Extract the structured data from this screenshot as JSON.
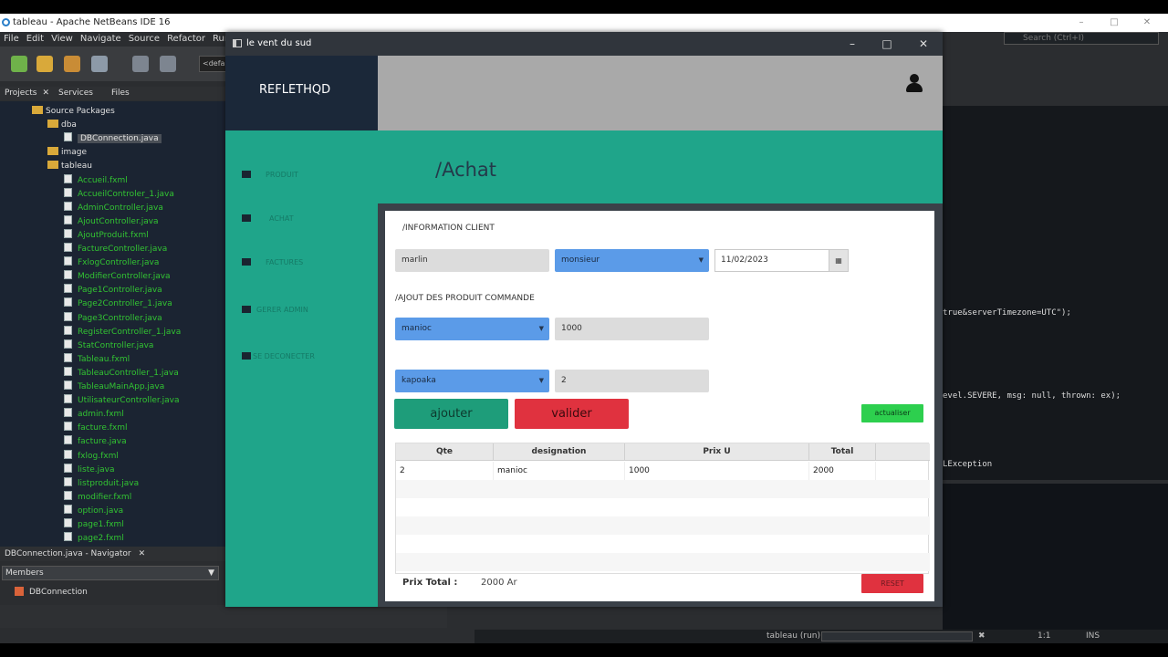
{
  "ide": {
    "title": "tableau - Apache NetBeans IDE 16",
    "menu": [
      "File",
      "Edit",
      "View",
      "Navigate",
      "Source",
      "Refactor",
      "Run"
    ],
    "toolbar_combo": "<defa",
    "search_placeholder": "Search (Ctrl+I)",
    "tabs": [
      "Projects",
      "Services",
      "Files"
    ],
    "tree": [
      {
        "label": "Source Packages",
        "color": "white",
        "kind": "pk",
        "indent": 35
      },
      {
        "label": "dba",
        "color": "white",
        "kind": "pk",
        "indent": 52
      },
      {
        "label": "DBConnection.java",
        "color": "white",
        "kind": "fi",
        "indent": 70,
        "selected": true
      },
      {
        "label": "image",
        "color": "white",
        "kind": "pk",
        "indent": 52
      },
      {
        "label": "tableau",
        "color": "white",
        "kind": "pk",
        "indent": 52
      },
      {
        "label": "Accueil.fxml",
        "color": "green",
        "kind": "fi",
        "indent": 70
      },
      {
        "label": "AccueilControler_1.java",
        "color": "green",
        "kind": "fi",
        "indent": 70
      },
      {
        "label": "AdminController.java",
        "color": "green",
        "kind": "fi",
        "indent": 70
      },
      {
        "label": "AjoutController.java",
        "color": "green",
        "kind": "fi",
        "indent": 70
      },
      {
        "label": "AjoutProduit.fxml",
        "color": "green",
        "kind": "fi",
        "indent": 70
      },
      {
        "label": "FactureController.java",
        "color": "green",
        "kind": "fi",
        "indent": 70
      },
      {
        "label": "FxlogController.java",
        "color": "green",
        "kind": "fi",
        "indent": 70
      },
      {
        "label": "ModifierController.java",
        "color": "green",
        "kind": "fi",
        "indent": 70
      },
      {
        "label": "Page1Controller.java",
        "color": "green",
        "kind": "fi",
        "indent": 70
      },
      {
        "label": "Page2Controller_1.java",
        "color": "green",
        "kind": "fi",
        "indent": 70
      },
      {
        "label": "Page3Controller.java",
        "color": "green",
        "kind": "fi",
        "indent": 70
      },
      {
        "label": "RegisterController_1.java",
        "color": "green",
        "kind": "fi",
        "indent": 70
      },
      {
        "label": "StatController.java",
        "color": "green",
        "kind": "fi",
        "indent": 70
      },
      {
        "label": "Tableau.fxml",
        "color": "green",
        "kind": "fi",
        "indent": 70
      },
      {
        "label": "TableauController_1.java",
        "color": "green",
        "kind": "fi",
        "indent": 70
      },
      {
        "label": "TableauMainApp.java",
        "color": "green",
        "kind": "fi",
        "indent": 70
      },
      {
        "label": "UtilisateurController.java",
        "color": "green",
        "kind": "fi",
        "indent": 70
      },
      {
        "label": "admin.fxml",
        "color": "green",
        "kind": "fi",
        "indent": 70
      },
      {
        "label": "facture.fxml",
        "color": "green",
        "kind": "fi",
        "indent": 70
      },
      {
        "label": "facture.java",
        "color": "green",
        "kind": "fi",
        "indent": 70
      },
      {
        "label": "fxlog.fxml",
        "color": "green",
        "kind": "fi",
        "indent": 70
      },
      {
        "label": "liste.java",
        "color": "green",
        "kind": "fi",
        "indent": 70
      },
      {
        "label": "listproduit.java",
        "color": "green",
        "kind": "fi",
        "indent": 70
      },
      {
        "label": "modifier.fxml",
        "color": "green",
        "kind": "fi",
        "indent": 70
      },
      {
        "label": "option.java",
        "color": "green",
        "kind": "fi",
        "indent": 70
      },
      {
        "label": "page1.fxml",
        "color": "green",
        "kind": "fi",
        "indent": 70
      },
      {
        "label": "page2.fxml",
        "color": "green",
        "kind": "fi",
        "indent": 70
      }
    ],
    "navigator_title": "DBConnection.java - Navigator",
    "members_label": "Members",
    "nav_item": "DBConnection",
    "code_lines": [
      "true&serverTimezone=UTC\");",
      "evel.SEVERE,  msg: null,  thrown: ex);",
      "LException"
    ],
    "status_run": "tableau (run)",
    "status_pos": "1:1",
    "status_ins": "INS"
  },
  "app": {
    "window_title": "le vent du sud",
    "brand": "REFLETHQD",
    "page_title": "/Achat",
    "nav": [
      {
        "label": "PRODUIT",
        "icon": "home-icon"
      },
      {
        "label": "ACHAT",
        "icon": "cash-icon"
      },
      {
        "label": "FACTURES",
        "icon": "book-icon"
      },
      {
        "label": "GERER ADMIN",
        "icon": "gear-icon"
      },
      {
        "label": "SE DECONECTER",
        "icon": "eject-icon"
      }
    ],
    "client_section": "/INFORMATION CLIENT",
    "client_name": "marlin",
    "civility": "monsieur",
    "date": "11/02/2023",
    "product_section": "/AJOUT DES PRODUIT COMMANDE",
    "product1": "manioc",
    "qty1": "1000",
    "product2": "kapoaka",
    "qty2": "2",
    "add_label": "ajouter",
    "validate_label": "valider",
    "refresh_label": "actualiser",
    "table": {
      "headers": [
        "Qte",
        "designation",
        "Prix U",
        "Total"
      ],
      "rows": [
        [
          "2",
          "manioc",
          "1000",
          "2000"
        ]
      ]
    },
    "total_label": "Prix Total :",
    "total_value": "2000 Ar",
    "reset_label": "RESET"
  }
}
